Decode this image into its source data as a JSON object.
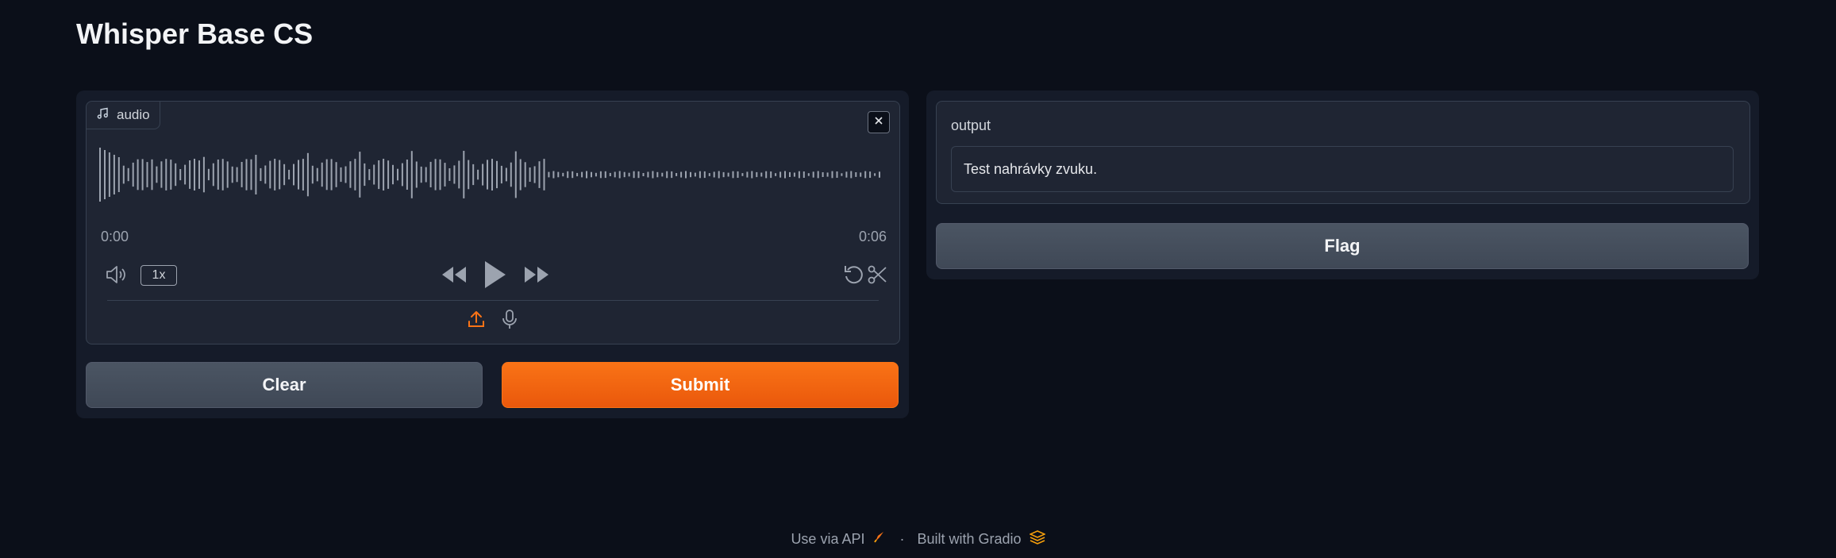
{
  "app": {
    "title": "Whisper Base CS"
  },
  "audio": {
    "label": "audio",
    "time_start": "0:00",
    "time_end": "0:06",
    "speed": "1x",
    "icons": [
      "music-note-icon",
      "close-icon",
      "volume-icon",
      "rewind-icon",
      "play-icon",
      "fast-forward-icon",
      "undo-icon",
      "scissors-icon",
      "upload-icon",
      "microphone-icon"
    ]
  },
  "buttons": {
    "clear": "Clear",
    "submit": "Submit",
    "flag": "Flag"
  },
  "output": {
    "label": "output",
    "value": "Test nahrávky zvuku."
  },
  "footer": {
    "api": "Use via API",
    "separator": "·",
    "built": "Built with Gradio"
  },
  "colors": {
    "background": "#0b0f19",
    "panel": "#151b29",
    "accent": "#f97316"
  }
}
